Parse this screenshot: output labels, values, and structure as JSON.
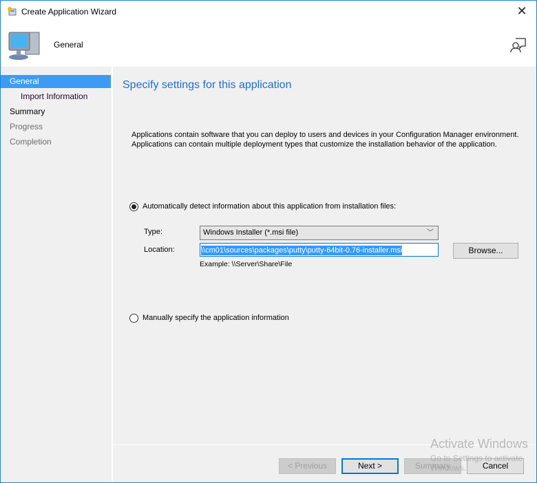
{
  "window": {
    "title": "Create Application Wizard"
  },
  "header": {
    "title": "General"
  },
  "nav": {
    "items": [
      {
        "label": "General",
        "state": "active"
      },
      {
        "label": "Import Information",
        "state": "sub"
      },
      {
        "label": "Summary",
        "state": "normal"
      },
      {
        "label": "Progress",
        "state": "disabled"
      },
      {
        "label": "Completion",
        "state": "disabled"
      }
    ]
  },
  "main": {
    "title": "Specify settings for this application",
    "description": [
      "Applications contain software that you can deploy to users and devices in your Configuration Manager environment.",
      "Applications can contain multiple deployment types that customize the installation behavior of the application."
    ],
    "auto_radio": {
      "label": "Automatically detect information about this application from installation files:",
      "checked": true
    },
    "type_label": "Type:",
    "type_value": "Windows Installer (*.msi file)",
    "location_label": "Location:",
    "location_value": "\\\\cm01\\sources\\packages\\putty\\putty-64bit-0.76-installer.msi",
    "browse": "Browse...",
    "example": "Example: \\\\Server\\Share\\File",
    "manual_radio": {
      "label": "Manually specify the application information",
      "checked": false
    }
  },
  "buttons": {
    "previous": "< Previous",
    "next": "Next >",
    "summary": "Summary",
    "cancel": "Cancel"
  },
  "watermark": {
    "line1": "Activate Windows",
    "line2": "Go to Settings to activate Windows."
  },
  "colors": {
    "accent": "#3c9cf5",
    "title_blue": "#1f6fd0",
    "border": "#1883d7"
  }
}
